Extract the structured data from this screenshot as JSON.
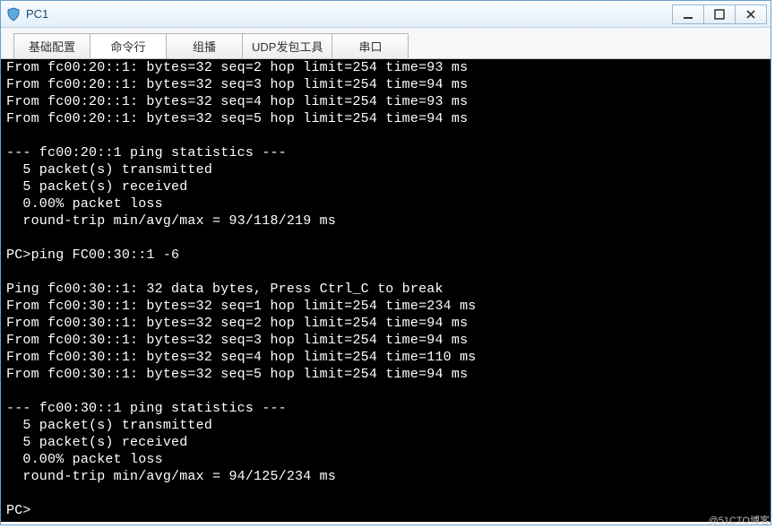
{
  "window": {
    "title": "PC1"
  },
  "tabs": [
    {
      "label": "基础配置",
      "active": false
    },
    {
      "label": "命令行",
      "active": true
    },
    {
      "label": "组播",
      "active": false
    },
    {
      "label": "UDP发包工具",
      "active": false
    },
    {
      "label": "串口",
      "active": false
    }
  ],
  "terminal": {
    "lines": [
      "From fc00:20::1: bytes=32 seq=2 hop limit=254 time=93 ms",
      "From fc00:20::1: bytes=32 seq=3 hop limit=254 time=94 ms",
      "From fc00:20::1: bytes=32 seq=4 hop limit=254 time=93 ms",
      "From fc00:20::1: bytes=32 seq=5 hop limit=254 time=94 ms",
      "",
      "--- fc00:20::1 ping statistics ---",
      "  5 packet(s) transmitted",
      "  5 packet(s) received",
      "  0.00% packet loss",
      "  round-trip min/avg/max = 93/118/219 ms",
      "",
      "PC>ping FC00:30::1 -6",
      "",
      "Ping fc00:30::1: 32 data bytes, Press Ctrl_C to break",
      "From fc00:30::1: bytes=32 seq=1 hop limit=254 time=234 ms",
      "From fc00:30::1: bytes=32 seq=2 hop limit=254 time=94 ms",
      "From fc00:30::1: bytes=32 seq=3 hop limit=254 time=94 ms",
      "From fc00:30::1: bytes=32 seq=4 hop limit=254 time=110 ms",
      "From fc00:30::1: bytes=32 seq=5 hop limit=254 time=94 ms",
      "",
      "--- fc00:30::1 ping statistics ---",
      "  5 packet(s) transmitted",
      "  5 packet(s) received",
      "  0.00% packet loss",
      "  round-trip min/avg/max = 94/125/234 ms",
      "",
      "PC>"
    ],
    "cursor_on_line": 21,
    "cursor_col": 26
  },
  "watermark": "@51CTO博客"
}
